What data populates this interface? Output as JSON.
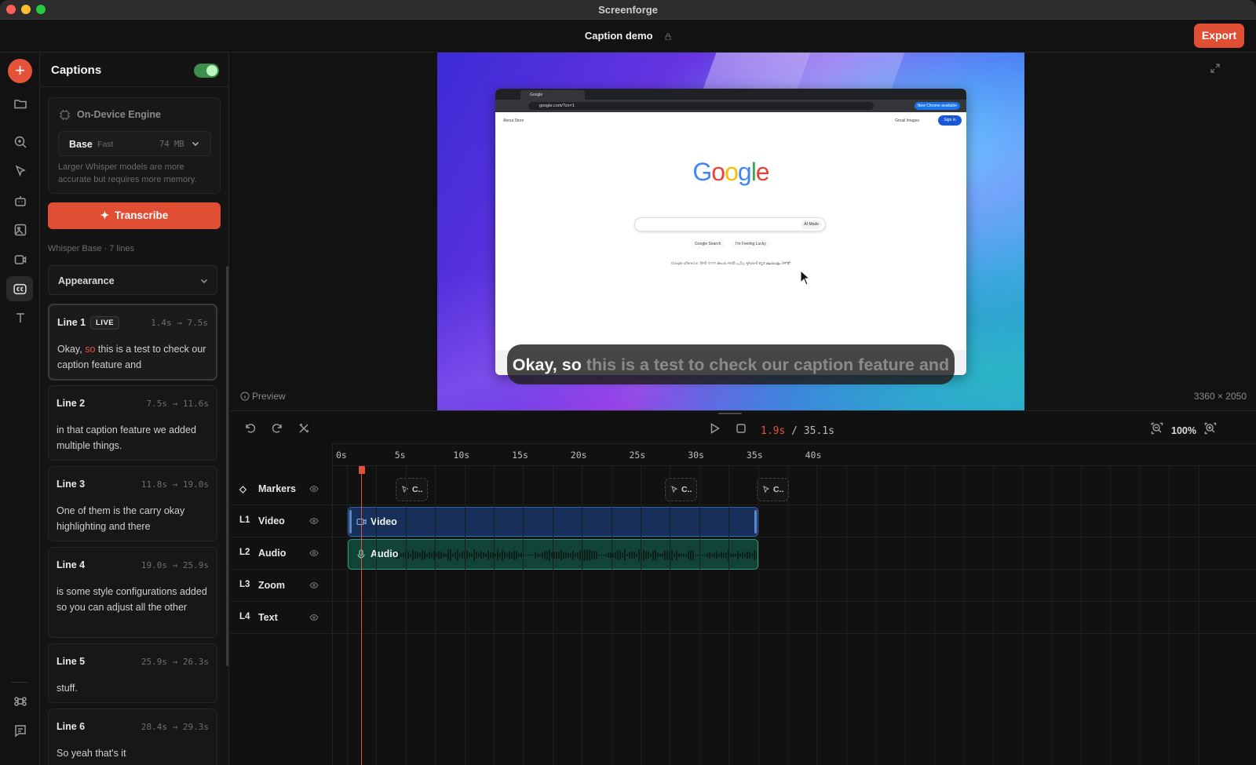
{
  "window": {
    "app_title": "Screenforge"
  },
  "header": {
    "document_title": "Caption demo",
    "export_label": "Export"
  },
  "captions_panel": {
    "title": "Captions",
    "enabled": true,
    "engine": {
      "title": "On-Device Engine",
      "model_name": "Base",
      "model_speed": "Fast",
      "model_size": "74 MB",
      "note": "Larger Whisper models are more accurate but requires more memory."
    },
    "transcribe_label": "Transcribe",
    "meta": "Whisper Base · 7 lines",
    "appearance_label": "Appearance",
    "lines": [
      {
        "title": "Line 1",
        "badge": "LIVE",
        "time": "1.4s → 7.5s",
        "text_before": "Okay, ",
        "text_highlight": "so",
        "text_after": " this is a test to check our caption feature and"
      },
      {
        "title": "Line 2",
        "time": "7.5s → 11.6s",
        "text": "in that caption feature we added multiple things."
      },
      {
        "title": "Line 3",
        "time": "11.8s → 19.0s",
        "text": "One of them is the carry okay highlighting and there"
      },
      {
        "title": "Line 4",
        "time": "19.0s → 25.9s",
        "text": "is some style configurations added so you can adjust all the other"
      },
      {
        "title": "Line 5",
        "time": "25.9s → 26.3s",
        "text": "stuff."
      },
      {
        "title": "Line 6",
        "time": "28.4s → 29.3s",
        "text": "So yeah that's it"
      }
    ]
  },
  "preview": {
    "label": "Preview",
    "resolution": "3360 × 2050",
    "caption_spoken": "Okay, so",
    "caption_upcoming": " this is a test to check our caption feature and",
    "browser": {
      "tab_title": "Google",
      "url": "google.com/?zx=1",
      "new_chrome": "New Chrome available",
      "links_left": "About   Store",
      "links_right": "Gmail   Images",
      "sign_in": "Sign in",
      "search_ai_mode": "AI Mode",
      "btn_search": "Google Search",
      "btn_lucky": "I'm Feeling Lucky",
      "languages": "Google offered in:  हिन्दी  বাংলা  తెలుగు  मराठी  தமிழ்  ગુજરાતી  ಕನ್ನಡ  മലയാളം  ਪੰਜਾਬੀ"
    }
  },
  "timeline": {
    "current_time": "1.9s",
    "separator": " / ",
    "total_time": "35.1s",
    "zoom": "100%",
    "ruler_labels": [
      "0s",
      "5s",
      "10s",
      "15s",
      "20s",
      "25s",
      "30s",
      "35s",
      "40s"
    ],
    "playhead_seconds": 1.9,
    "tracks": [
      {
        "tag": "◇",
        "name": "Markers"
      },
      {
        "tag": "L1",
        "name": "Video"
      },
      {
        "tag": "L2",
        "name": "Audio"
      },
      {
        "tag": "L3",
        "name": "Zoom"
      },
      {
        "tag": "L4",
        "name": "Text"
      }
    ],
    "markers": [
      {
        "label": "C.."
      },
      {
        "label": "C.."
      },
      {
        "label": "C.."
      }
    ],
    "clips": {
      "video_label": "Video",
      "audio_label": "Audio"
    }
  },
  "colors": {
    "accent": "#e04e34",
    "video_clip": "#17305a",
    "audio_clip": "#114338",
    "toggle_on": "#3c8f4a"
  }
}
